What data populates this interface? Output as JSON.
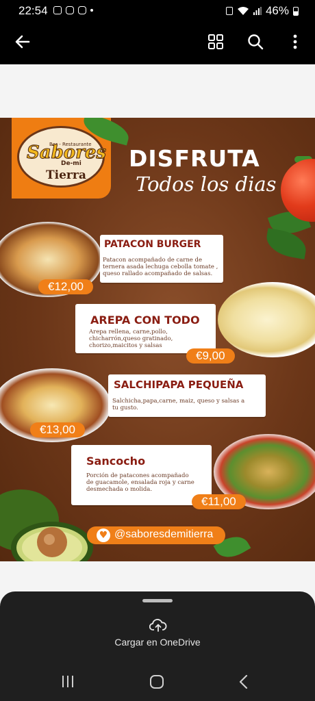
{
  "status_bar": {
    "time": "22:54",
    "battery": "46%"
  },
  "app_bar": {
    "icons": [
      "back-arrow-icon",
      "grid-view-icon",
      "search-icon",
      "more-vert-icon"
    ]
  },
  "poster": {
    "logo": {
      "small_text": "Bar - Restaurante",
      "name": "Sabores",
      "de_mi": "De-mi",
      "tierra": "Tierra"
    },
    "headline": "DISFRUTA",
    "subheadline": "Todos los dias",
    "items": [
      {
        "name": "PATACON BURGER",
        "description": "Patacon acompañado de carne de ternera asada  lechuga cebolla tomate , queso rallado acompañado de salsas.",
        "price": "€12,00"
      },
      {
        "name": "AREPA CON TODO",
        "description": "Arepa rellena, carne,pollo, chicharrón,queso gratinado, chorizo,maicitos y salsas",
        "price": "€9,00"
      },
      {
        "name": "SALCHIPAPA PEQUEÑA",
        "description": "Salchicha,papa,carne, maiz, queso y salsas a tu gusto.",
        "price": "€13,00"
      },
      {
        "name": "Sancocho",
        "description": "Porción de patacones acompañado de guacamole, ensalada roja y carne desmechada o molida.",
        "price": "€11,00"
      }
    ],
    "social_handle": "@saboresdemitierra"
  },
  "bottom_sheet": {
    "action_label": "Cargar en OneDrive"
  },
  "colors": {
    "orange": "#f07f18",
    "brown": "#6b3618",
    "title_red": "#8a1d12"
  }
}
